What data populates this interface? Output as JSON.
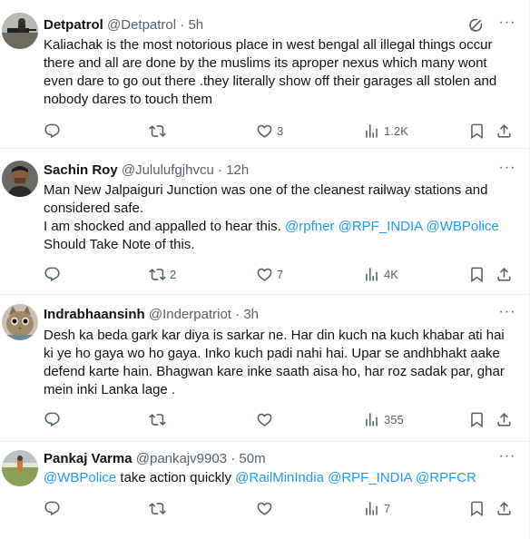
{
  "tweets": [
    {
      "name": "Detpatrol",
      "handle": "@Detpatrol",
      "time": "5h",
      "text": "Kaliachak is the most notorious place in west bengal all illegal things occur there and all are done by the muslims its aproper nexus which many wont even dare to go out there .they literally show off  their garages all stolen and nobody dares to touch them",
      "replies": "",
      "reposts": "",
      "likes": "3",
      "views": "1.2K"
    },
    {
      "name": "Sachin Roy",
      "handle": "@Jululufgjhvcu",
      "time": "12h",
      "text_line1": "Man New Jalpaiguri Junction was one of the cleanest railway stations and considered safe.",
      "text_line2": "I am shocked and appalled to hear this.",
      "mention1": "@rpfner",
      "mention2": "@RPF_INDIA",
      "mention3": "@WBPolice",
      "text_line3": "Should Take Note of this.",
      "replies": "",
      "reposts": "2",
      "likes": "7",
      "views": "4K"
    },
    {
      "name": "Indrabhaansinh",
      "handle": "@Inderpatriot",
      "time": "3h",
      "text": "Desh ka beda gark kar diya is sarkar ne. Har din kuch na kuch khabar ati hai ki ye ho gaya wo ho gaya. Inko kuch padi nahi hai. Upar se andhbhakt aake defend karte hain. Bhagwan kare inke saath aisa ho, har roz sadak par, ghar mein inki Lanka lage .",
      "replies": "",
      "reposts": "",
      "likes": "",
      "views": "355"
    },
    {
      "name": "Pankaj Varma",
      "handle": "@pankajv9903",
      "time": "50m",
      "mention1": "@WBPolice",
      "text_mid": " take action quickly ",
      "mention2": "@RailMinIndia",
      "mention3": "@RPF_INDIA",
      "mention4": "@RPFCR",
      "replies": "",
      "reposts": "",
      "likes": "",
      "views": "7"
    }
  ],
  "separator": " · ",
  "icons": {
    "reply": "reply-icon",
    "repost": "repost-icon",
    "like": "heart-icon",
    "views": "analytics-icon",
    "bookmark": "bookmark-icon",
    "share": "share-icon",
    "grok": "grok-icon",
    "more": "more-icon"
  },
  "colors": {
    "text": "#0f1419",
    "secondary": "#536471",
    "link": "#1d9bf0",
    "divider": "#eff3f4"
  }
}
